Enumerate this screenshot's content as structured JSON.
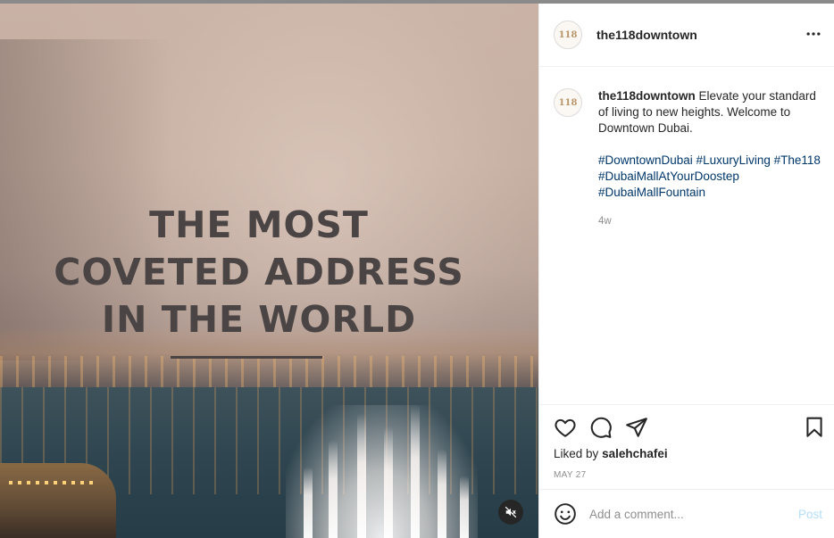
{
  "media": {
    "headline_lines": [
      "THE MOST",
      "COVETED ADDRESS",
      "IN THE WORLD"
    ],
    "mute_icon": "speaker-muted-icon"
  },
  "post": {
    "username": "the118downtown",
    "avatar_text": "118",
    "more_icon": "more-horizontal-icon",
    "caption": {
      "username": "the118downtown",
      "text": "Elevate your standard of living to new heights. Welcome to Downtown Dubai.",
      "hashtags": "#DowntownDubai #LuxuryLiving #The118 #DubaiMallAtYourDoostep #DubaiMallFountain",
      "time_ago": "4w"
    },
    "actions": {
      "icons": [
        "heart-icon",
        "comment-icon",
        "share-icon",
        "bookmark-icon"
      ],
      "liked_prefix": "Liked by",
      "liked_user": "salehchafei",
      "date": "MAY 27"
    },
    "comment": {
      "placeholder": "Add a comment...",
      "post_label": "Post",
      "emoji_icon": "emoji-icon"
    }
  },
  "colors": {
    "link": "#00376b",
    "muted": "#8e8e8e",
    "post_button_disabled": "#b2dffc"
  }
}
